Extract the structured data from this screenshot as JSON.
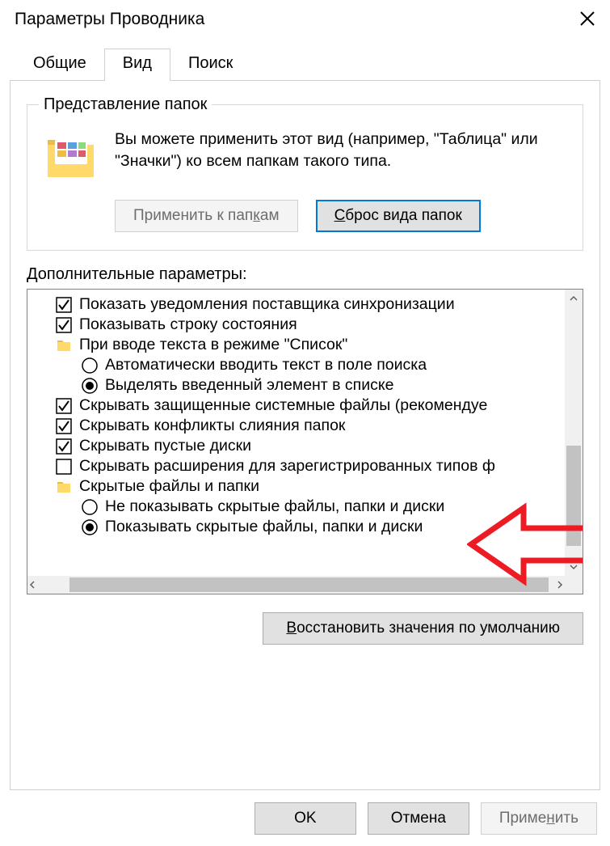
{
  "window": {
    "title": "Параметры Проводника"
  },
  "tabs": {
    "general": "Общие",
    "view": "Вид",
    "search": "Поиск"
  },
  "folder_views": {
    "legend": "Представление папок",
    "description": "Вы можете применить этот вид (например, \"Таблица\" или \"Значки\") ко всем папкам такого типа.",
    "apply_btn": "Применить к папкам",
    "reset_btn": "Сброс вида папок"
  },
  "advanced": {
    "label": "Дополнительные параметры:",
    "items": [
      {
        "type": "check",
        "checked": true,
        "level": 1,
        "label": "Показать уведомления поставщика синхронизации"
      },
      {
        "type": "check",
        "checked": true,
        "level": 1,
        "label": "Показывать строку состояния"
      },
      {
        "type": "folder",
        "level": 1,
        "label": "При вводе текста в режиме \"Список\""
      },
      {
        "type": "radio",
        "checked": false,
        "level": 2,
        "label": "Автоматически вводить текст в поле поиска"
      },
      {
        "type": "radio",
        "checked": true,
        "level": 2,
        "label": "Выделять введенный элемент в списке"
      },
      {
        "type": "check",
        "checked": true,
        "level": 1,
        "label": "Скрывать защищенные системные файлы (рекомендуе"
      },
      {
        "type": "check",
        "checked": true,
        "level": 1,
        "label": "Скрывать конфликты слияния папок"
      },
      {
        "type": "check",
        "checked": true,
        "level": 1,
        "label": "Скрывать пустые диски"
      },
      {
        "type": "check",
        "checked": false,
        "level": 1,
        "label": "Скрывать расширения для зарегистрированных типов ф"
      },
      {
        "type": "folder",
        "level": 1,
        "label": "Скрытые файлы и папки"
      },
      {
        "type": "radio",
        "checked": false,
        "level": 2,
        "label": "Не показывать скрытые файлы, папки и диски"
      },
      {
        "type": "radio",
        "checked": true,
        "level": 2,
        "label": "Показывать скрытые файлы, папки и диски"
      }
    ],
    "restore_btn": "Восстановить значения по умолчанию"
  },
  "footer": {
    "ok": "OK",
    "cancel": "Отмена",
    "apply": "Применить"
  }
}
